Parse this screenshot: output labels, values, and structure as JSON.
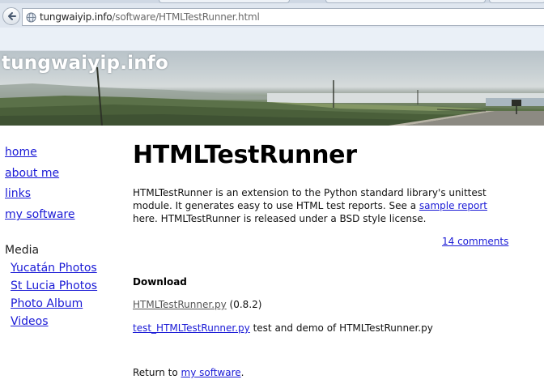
{
  "browser": {
    "url_host": "tungwaiyip.info",
    "url_path": "/software/HTMLTestRunner.html"
  },
  "site": {
    "title": "tungwaiyip.info"
  },
  "sidebar": {
    "nav": [
      {
        "label": "home"
      },
      {
        "label": "about me"
      },
      {
        "label": "links"
      },
      {
        "label": "my software"
      }
    ],
    "media_heading": "Media",
    "media": [
      {
        "label": "Yucatán Photos"
      },
      {
        "label": "St Lucia Photos"
      },
      {
        "label": "Photo Album"
      },
      {
        "label": "Videos"
      }
    ]
  },
  "main": {
    "title": "HTMLTestRunner",
    "intro_before_link": "HTMLTestRunner is an extension to the Python standard library's unittest module. It generates easy to use HTML test reports. See a ",
    "intro_link": "sample report",
    "intro_after_link": " here. HTMLTestRunner is released under a BSD style license.",
    "comments_link": "14 comments",
    "download_heading": "Download",
    "files": [
      {
        "link": "HTMLTestRunner.py",
        "description": " (0.8.2)"
      },
      {
        "link": "test_HTMLTestRunner.py",
        "description": " test and demo of HTMLTestRunner.py"
      }
    ],
    "return_prefix": "Return to ",
    "return_link": "my software",
    "return_suffix": "."
  },
  "colors": {
    "link": "#1a1ad6",
    "visited_link": "#555555",
    "chrome": "#dfe6ef"
  },
  "icons": {
    "back": "back-arrow-icon",
    "site": "globe-icon"
  }
}
